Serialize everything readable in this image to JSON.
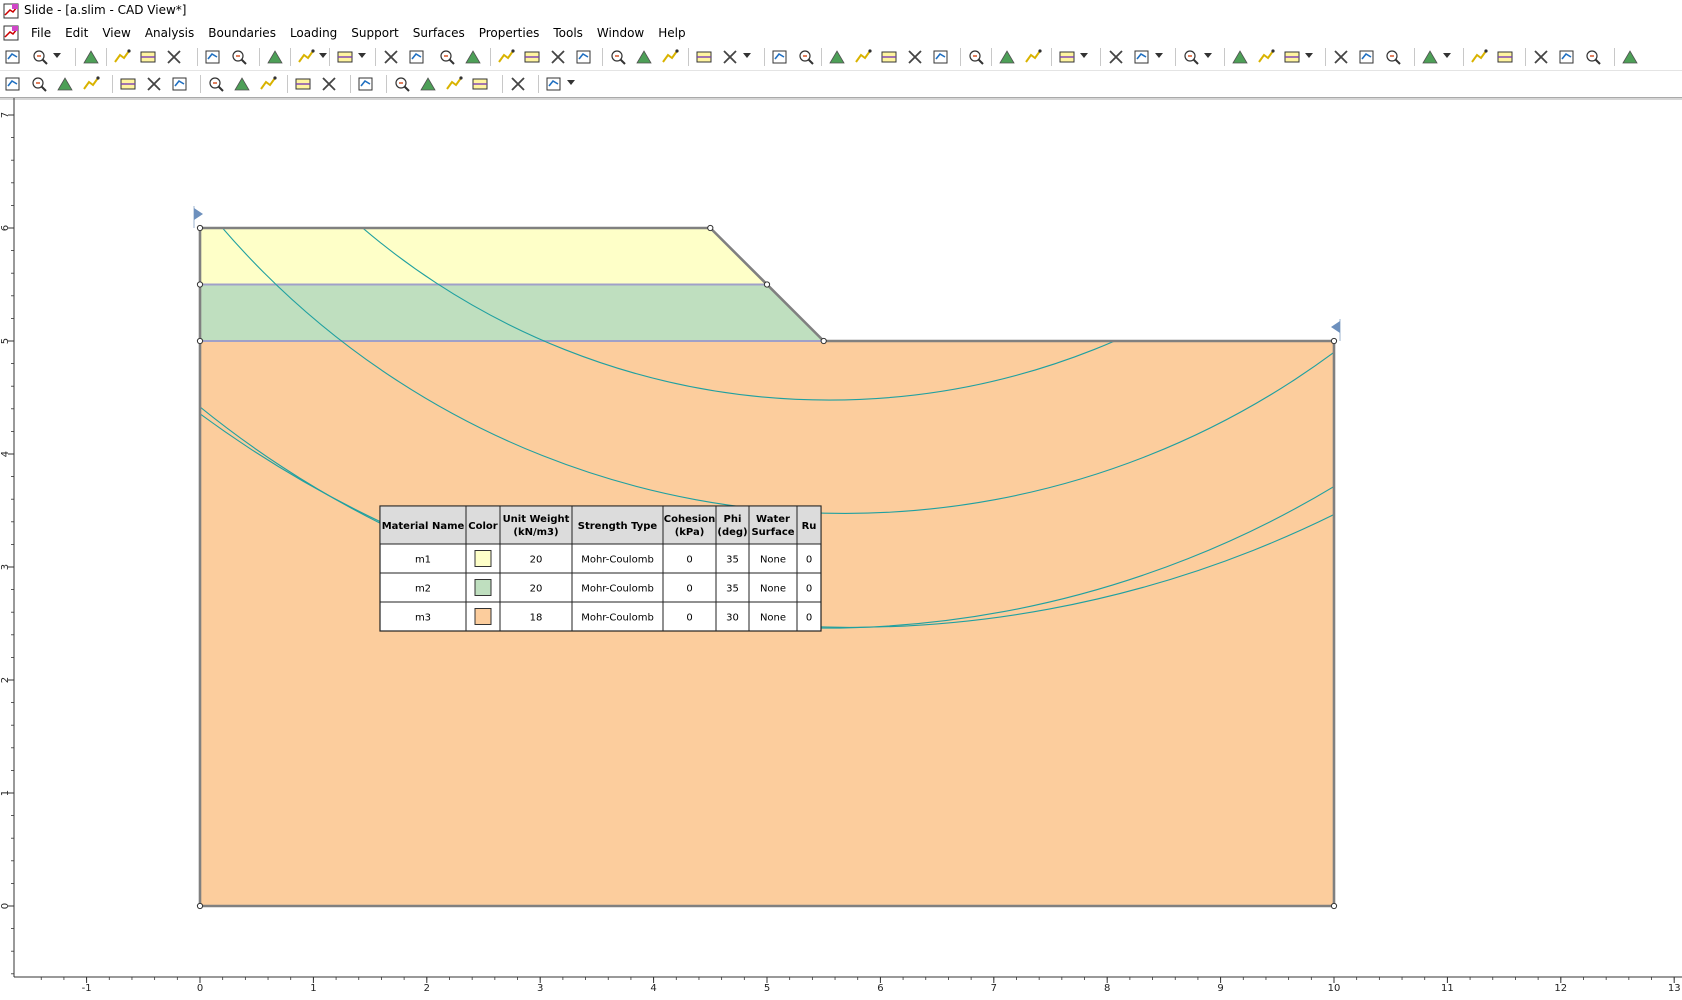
{
  "window": {
    "title": "Slide - [a.slim - CAD View*]"
  },
  "menu": [
    "File",
    "Edit",
    "View",
    "Analysis",
    "Boundaries",
    "Loading",
    "Support",
    "Surfaces",
    "Properties",
    "Tools",
    "Window",
    "Help"
  ],
  "toolbar1": [
    {
      "name": "new-file-icon",
      "x": 3,
      "drop": false
    },
    {
      "name": "open-file-icon",
      "x": 30,
      "drop": true
    },
    {
      "name": "save-icon",
      "x": 81,
      "drop": false
    },
    {
      "name": "print-preview-icon",
      "x": 112,
      "drop": false
    },
    {
      "name": "print-icon",
      "x": 138,
      "drop": false
    },
    {
      "name": "scale-icon",
      "x": 164,
      "drop": false
    },
    {
      "name": "copy-icon",
      "x": 203,
      "drop": false
    },
    {
      "name": "info-viewer-icon",
      "x": 229,
      "drop": false
    },
    {
      "name": "display-options-icon",
      "x": 265,
      "drop": false
    },
    {
      "name": "undo-icon",
      "x": 296,
      "drop": true
    },
    {
      "name": "redo-icon",
      "x": 335,
      "drop": true
    },
    {
      "name": "compute-icon",
      "x": 381,
      "drop": false
    },
    {
      "name": "interpret-icon",
      "x": 407,
      "drop": false
    },
    {
      "name": "project-settings-icon",
      "x": 437,
      "drop": false
    },
    {
      "name": "material-icon",
      "x": 463,
      "drop": false
    },
    {
      "name": "zoom-all-icon",
      "x": 496,
      "drop": false
    },
    {
      "name": "zoom-in-icon",
      "x": 522,
      "drop": false
    },
    {
      "name": "zoom-out-icon",
      "x": 548,
      "drop": false
    },
    {
      "name": "pan-icon",
      "x": 574,
      "drop": false
    },
    {
      "name": "zoom-window-icon",
      "x": 608,
      "drop": false
    },
    {
      "name": "zoom-extents-icon",
      "x": 634,
      "drop": false
    },
    {
      "name": "zoom-previous-icon",
      "x": 660,
      "drop": false
    },
    {
      "name": "boundary-icon",
      "x": 694,
      "drop": false
    },
    {
      "name": "add-boundary-icon",
      "x": 720,
      "drop": true
    },
    {
      "name": "external-boundary-icon",
      "x": 770,
      "drop": false
    },
    {
      "name": "material-boundary-icon",
      "x": 796,
      "drop": false
    },
    {
      "name": "delete-boundary-icon",
      "x": 827,
      "drop": false
    },
    {
      "name": "add-vertex-icon",
      "x": 853,
      "drop": false
    },
    {
      "name": "move-vertices-icon",
      "x": 879,
      "drop": false
    },
    {
      "name": "merge-vertices-icon",
      "x": 905,
      "drop": false
    },
    {
      "name": "delete-vertex-icon",
      "x": 931,
      "drop": false
    },
    {
      "name": "select-icon",
      "x": 966,
      "drop": false
    },
    {
      "name": "slip-grid-icon",
      "x": 997,
      "drop": false
    },
    {
      "name": "slope-limits-icon",
      "x": 1023,
      "drop": false
    },
    {
      "name": "water-table-icon",
      "x": 1057,
      "drop": true
    },
    {
      "name": "add-line-icon",
      "x": 1106,
      "drop": false
    },
    {
      "name": "piezo-line-icon",
      "x": 1132,
      "drop": true
    },
    {
      "name": "support-icon",
      "x": 1181,
      "drop": true
    },
    {
      "name": "distributed-load-icon",
      "x": 1230,
      "drop": false
    },
    {
      "name": "line-load-icon",
      "x": 1256,
      "drop": false
    },
    {
      "name": "seismic-load-icon",
      "x": 1282,
      "drop": true
    },
    {
      "name": "assign-properties-icon",
      "x": 1331,
      "drop": false
    },
    {
      "name": "assign-surface-icon",
      "x": 1357,
      "drop": false
    },
    {
      "name": "assign-support-icon",
      "x": 1383,
      "drop": false
    },
    {
      "name": "surface-options-icon",
      "x": 1420,
      "drop": true
    },
    {
      "name": "grid-search-icon",
      "x": 1469,
      "drop": false
    },
    {
      "name": "slope-search-icon",
      "x": 1495,
      "drop": false
    },
    {
      "name": "tension-crack-icon",
      "x": 1531,
      "drop": false
    },
    {
      "name": "check-geometry-icon",
      "x": 1557,
      "drop": false
    },
    {
      "name": "legend-icon",
      "x": 1583,
      "drop": false
    },
    {
      "name": "exit-icon",
      "x": 1620,
      "drop": false
    }
  ],
  "toolbar2": [
    {
      "name": "sheet-view-icon",
      "x": 3,
      "drop": false
    },
    {
      "name": "table-icon",
      "x": 29,
      "drop": false
    },
    {
      "name": "table-alt-icon",
      "x": 55,
      "drop": false
    },
    {
      "name": "table-grey-icon",
      "x": 81,
      "drop": false
    },
    {
      "name": "line-tool-icon",
      "x": 118,
      "drop": false
    },
    {
      "name": "arrow-tool-icon",
      "x": 144,
      "drop": false
    },
    {
      "name": "dimension-tool-icon",
      "x": 170,
      "drop": false
    },
    {
      "name": "pencil-tool-icon",
      "x": 206,
      "drop": false
    },
    {
      "name": "arc-tool-icon",
      "x": 232,
      "drop": false
    },
    {
      "name": "fill-tool-icon",
      "x": 258,
      "drop": false
    },
    {
      "name": "rectangle-tool-icon",
      "x": 293,
      "drop": false
    },
    {
      "name": "ellipse-tool-icon",
      "x": 319,
      "drop": false
    },
    {
      "name": "image-tool-icon",
      "x": 356,
      "drop": false
    },
    {
      "name": "angle-tool-icon",
      "x": 392,
      "drop": false
    },
    {
      "name": "ruler-tool-icon",
      "x": 418,
      "drop": false
    },
    {
      "name": "slope-tool-icon",
      "x": 444,
      "drop": false
    },
    {
      "name": "measure-angle-icon",
      "x": 470,
      "drop": false
    },
    {
      "name": "coordinates-tool-icon",
      "x": 508,
      "drop": false
    },
    {
      "name": "eraser-tool-icon",
      "x": 544,
      "drop": true
    }
  ],
  "axes": {
    "x_ticks": [
      "-1",
      "0",
      "1",
      "2",
      "3",
      "4",
      "5",
      "6",
      "7",
      "8",
      "9",
      "10",
      "11",
      "12",
      "13"
    ],
    "y_ticks": [
      "0",
      "1",
      "2",
      "3",
      "4",
      "5",
      "6",
      "7"
    ]
  },
  "model": {
    "slope_points": [
      [
        0,
        0
      ],
      [
        10,
        0
      ],
      [
        10,
        5
      ],
      [
        5.5,
        5
      ],
      [
        4.5,
        6
      ],
      [
        0,
        6
      ]
    ],
    "materials": [
      {
        "name": "m1",
        "fill": "#feffc8"
      },
      {
        "name": "m2",
        "fill": "#bfdfbf"
      },
      {
        "name": "m3",
        "fill": "#fccd9d"
      }
    ],
    "colors": {
      "boundary": "#808080",
      "surface": "#20a0a0"
    }
  },
  "table": {
    "headers": [
      "Material Name",
      "Color",
      "Unit Weight (kN/m3)",
      "Strength Type",
      "Cohesion (kPa)",
      "Phi (deg)",
      "Water Surface",
      "Ru"
    ],
    "rows": [
      {
        "name": "m1",
        "color": "#feffc8",
        "unit_weight": "20",
        "strength": "Mohr-Coulomb",
        "cohesion": "0",
        "phi": "35",
        "water": "None",
        "ru": "0"
      },
      {
        "name": "m2",
        "color": "#bfdfbf",
        "unit_weight": "20",
        "strength": "Mohr-Coulomb",
        "cohesion": "0",
        "phi": "35",
        "water": "None",
        "ru": "0"
      },
      {
        "name": "m3",
        "color": "#fccd9d",
        "unit_weight": "18",
        "strength": "Mohr-Coulomb",
        "cohesion": "0",
        "phi": "30",
        "water": "None",
        "ru": "0"
      }
    ]
  }
}
